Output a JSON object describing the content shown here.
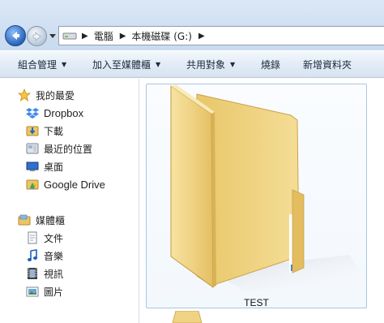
{
  "address": {
    "breadcrumbs": [
      "電腦",
      "本機磁碟 (G:)"
    ]
  },
  "toolbar": {
    "organize": "組合管理",
    "add_to_library": "加入至媒體櫃",
    "share_with": "共用對象",
    "burn": "燒錄",
    "new_folder": "新增資料夾"
  },
  "sidebar": {
    "favorites_header": "我的最愛",
    "favorites": [
      {
        "label": "Dropbox",
        "icon": "dropbox-icon"
      },
      {
        "label": "下載",
        "icon": "downloads-folder-icon"
      },
      {
        "label": "最近的位置",
        "icon": "recent-places-icon"
      },
      {
        "label": "桌面",
        "icon": "desktop-icon"
      },
      {
        "label": "Google Drive",
        "icon": "google-drive-icon"
      }
    ],
    "libraries_header": "媒體櫃",
    "libraries": [
      {
        "label": "文件",
        "icon": "documents-icon"
      },
      {
        "label": "音樂",
        "icon": "music-icon"
      },
      {
        "label": "視訊",
        "icon": "video-icon"
      },
      {
        "label": "圖片",
        "icon": "pictures-icon"
      }
    ]
  },
  "content": {
    "items": [
      {
        "name": "TEST",
        "icon": "folder-icon",
        "selected": true
      }
    ]
  },
  "colors": {
    "selection_border": "#a9c5e3",
    "toolbar_bg": "#dfe9f5",
    "folder_yellow": "#f3d98a"
  }
}
